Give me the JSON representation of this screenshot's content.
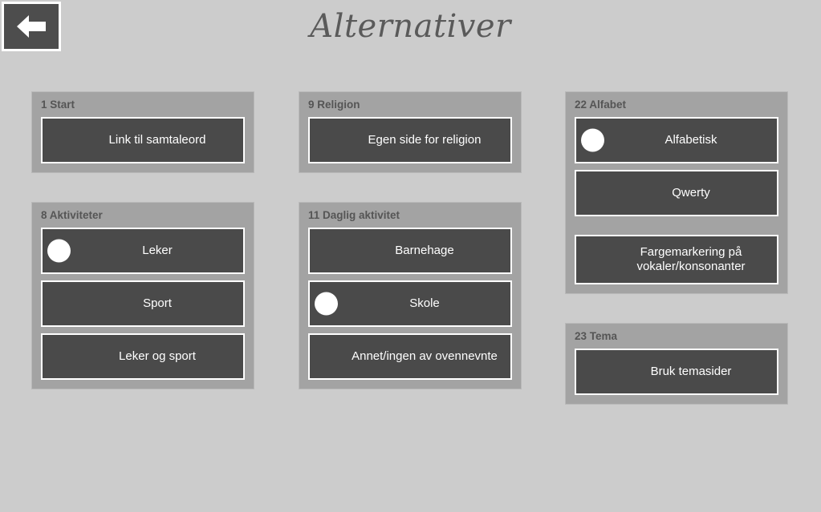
{
  "header": {
    "title": "Alternativer",
    "back_button_icon": "arrow-left-icon"
  },
  "columns": [
    {
      "id": "column-left",
      "panels": [
        {
          "id": "panel-start",
          "header": "1 Start",
          "options": [
            {
              "label": "Link til samtaleord",
              "selected": false
            }
          ]
        },
        {
          "id": "panel-aktiviteter",
          "header": "8 Aktiviteter",
          "options": [
            {
              "label": "Leker",
              "selected": true
            },
            {
              "label": "Sport",
              "selected": false
            },
            {
              "label": "Leker og sport",
              "selected": false
            }
          ]
        }
      ]
    },
    {
      "id": "column-middle",
      "panels": [
        {
          "id": "panel-religion",
          "header": "9 Religion",
          "options": [
            {
              "label": "Egen side for religion",
              "selected": false
            }
          ]
        },
        {
          "id": "panel-daglig-aktivitet",
          "header": "11 Daglig aktivitet",
          "options": [
            {
              "label": "Barnehage",
              "selected": false
            },
            {
              "label": "Skole",
              "selected": true
            },
            {
              "label": "Annet/ingen av ovennevnte",
              "selected": false
            }
          ]
        }
      ]
    },
    {
      "id": "column-right",
      "panels": [
        {
          "id": "panel-alfabet",
          "header": "22 Alfabet",
          "options": [
            {
              "label": "Alfabetisk",
              "selected": true
            },
            {
              "label": "Qwerty",
              "selected": false
            },
            {
              "label": "Fargemarkering på vokaler/konsonanter",
              "selected": false,
              "spaced": true,
              "wrap": true
            }
          ]
        },
        {
          "id": "panel-tema",
          "header": "23 Tema",
          "options": [
            {
              "label": "Bruk temasider",
              "selected": false
            }
          ]
        }
      ]
    }
  ],
  "colors": {
    "page_background": "#cccccc",
    "panel_background": "#a3a3a3",
    "option_background": "#4a4a4a",
    "option_border": "#ffffff",
    "header_text": "#555555",
    "title_text": "#5a5a5a"
  }
}
